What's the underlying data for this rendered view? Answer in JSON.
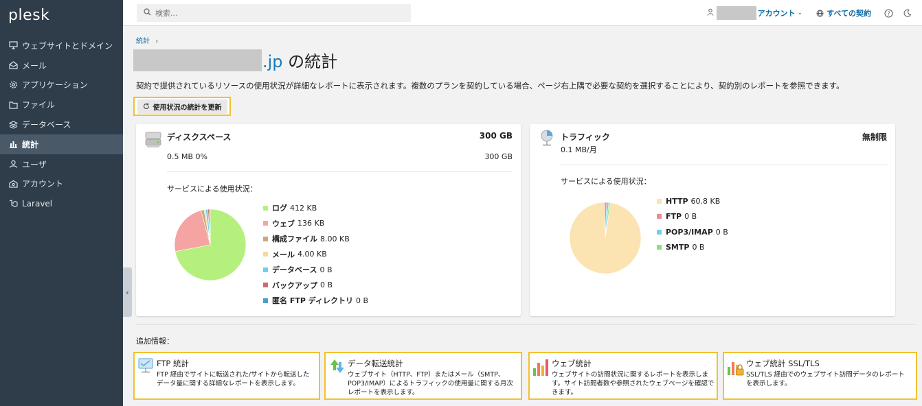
{
  "app": {
    "logo": "plesk"
  },
  "sidebar": {
    "items": [
      {
        "label": "ウェブサイトとドメイン",
        "icon": "monitor-icon",
        "active": false
      },
      {
        "label": "メール",
        "icon": "mail-icon",
        "active": false
      },
      {
        "label": "アプリケーション",
        "icon": "gear-icon",
        "active": false
      },
      {
        "label": "ファイル",
        "icon": "folder-icon",
        "active": false
      },
      {
        "label": "データベース",
        "icon": "database-icon",
        "active": false
      },
      {
        "label": "統計",
        "icon": "bar-chart-icon",
        "active": true
      },
      {
        "label": "ユーザ",
        "icon": "user-icon",
        "active": false
      },
      {
        "label": "アカウント",
        "icon": "account-icon",
        "active": false
      },
      {
        "label": "Laravel",
        "icon": "laravel-icon",
        "active": false
      }
    ]
  },
  "topbar": {
    "search_placeholder": "検索...",
    "account_label": "アカウント",
    "subscriptions_label": "すべての契約"
  },
  "breadcrumb": {
    "item": "統計",
    "sep": "›"
  },
  "page": {
    "title_domain_suffix": ".jp",
    "title_rest": " の統計",
    "description": "契約で提供されているリソースの使用状況が詳細なレポートに表示されます。複数のプランを契約している場合、ページ右上隅で必要な契約を選択することにより、契約別のレポートを参照できます。",
    "refresh_button": "使用状況の統計を更新"
  },
  "disk": {
    "title": "ディスクスペース",
    "total": "300 GB",
    "used": "0.5 MB 0%",
    "limit": "300 GB",
    "service_label": "サービスによる使用状況：",
    "legend": [
      {
        "name": "ログ",
        "value": "412 KB",
        "color": "#b5f07f"
      },
      {
        "name": "ウェブ",
        "value": "136 KB",
        "color": "#f5a3a3"
      },
      {
        "name": "構成ファイル",
        "value": "8.00 KB",
        "color": "#c9a97c"
      },
      {
        "name": "メール",
        "value": "4.00 KB",
        "color": "#f8d99a"
      },
      {
        "name": "データベース",
        "value": "0 B",
        "color": "#6fcfef"
      },
      {
        "name": "バックアップ",
        "value": "0 B",
        "color": "#cc6b6b"
      },
      {
        "name": "匿名 FTP ディレクトリ",
        "value": "0 B",
        "color": "#4a9fcf"
      }
    ]
  },
  "traffic": {
    "title": "トラフィック",
    "total": "無制限",
    "used": "0.1 MB/月",
    "service_label": "サービスによる使用状況：",
    "legend": [
      {
        "name": "HTTP",
        "value": "60.8 KB",
        "color": "#fbe3b2"
      },
      {
        "name": "FTP",
        "value": "0 B",
        "color": "#f28b8b"
      },
      {
        "name": "POP3/IMAP",
        "value": "0 B",
        "color": "#6fcfef"
      },
      {
        "name": "SMTP",
        "value": "0 B",
        "color": "#8ce07a"
      }
    ]
  },
  "chart_data": [
    {
      "type": "pie",
      "categories": [
        "ログ",
        "ウェブ",
        "構成ファイル",
        "メール",
        "データベース",
        "バックアップ",
        "匿名 FTP ディレクトリ"
      ],
      "values": [
        412,
        136,
        8,
        4,
        6,
        3,
        3
      ]
    },
    {
      "type": "pie",
      "categories": [
        "HTTP",
        "FTP",
        "POP3/IMAP",
        "SMTP"
      ],
      "values": [
        60.8,
        0.6,
        0.6,
        0.4
      ]
    }
  ],
  "extra": {
    "label": "追加情報：",
    "cards": [
      {
        "title": "FTP 統計",
        "desc": "FTP 経由でサイトに転送された/サイトから転送したデータ量に関する詳細なレポートを表示します。",
        "icon": "ftp-stats-icon"
      },
      {
        "title": "データ転送統計",
        "desc": "ウェブサイト（HTTP、FTP）またはメール（SMTP、POP3/IMAP）によるトラフィックの使用量に関する月次レポートを表示します。",
        "icon": "transfer-stats-icon"
      },
      {
        "title": "ウェブ統計",
        "desc": "ウェブサイトの訪問状況に関するレポートを表示します。サイト訪問者数や参照されたウェブページを確認できます。",
        "icon": "web-stats-icon"
      },
      {
        "title": "ウェブ統計 SSL/TLS",
        "desc": "SSL/TLS 経由でのウェブサイト訪問データのレポートを表示します。",
        "icon": "ssl-stats-icon"
      }
    ]
  }
}
